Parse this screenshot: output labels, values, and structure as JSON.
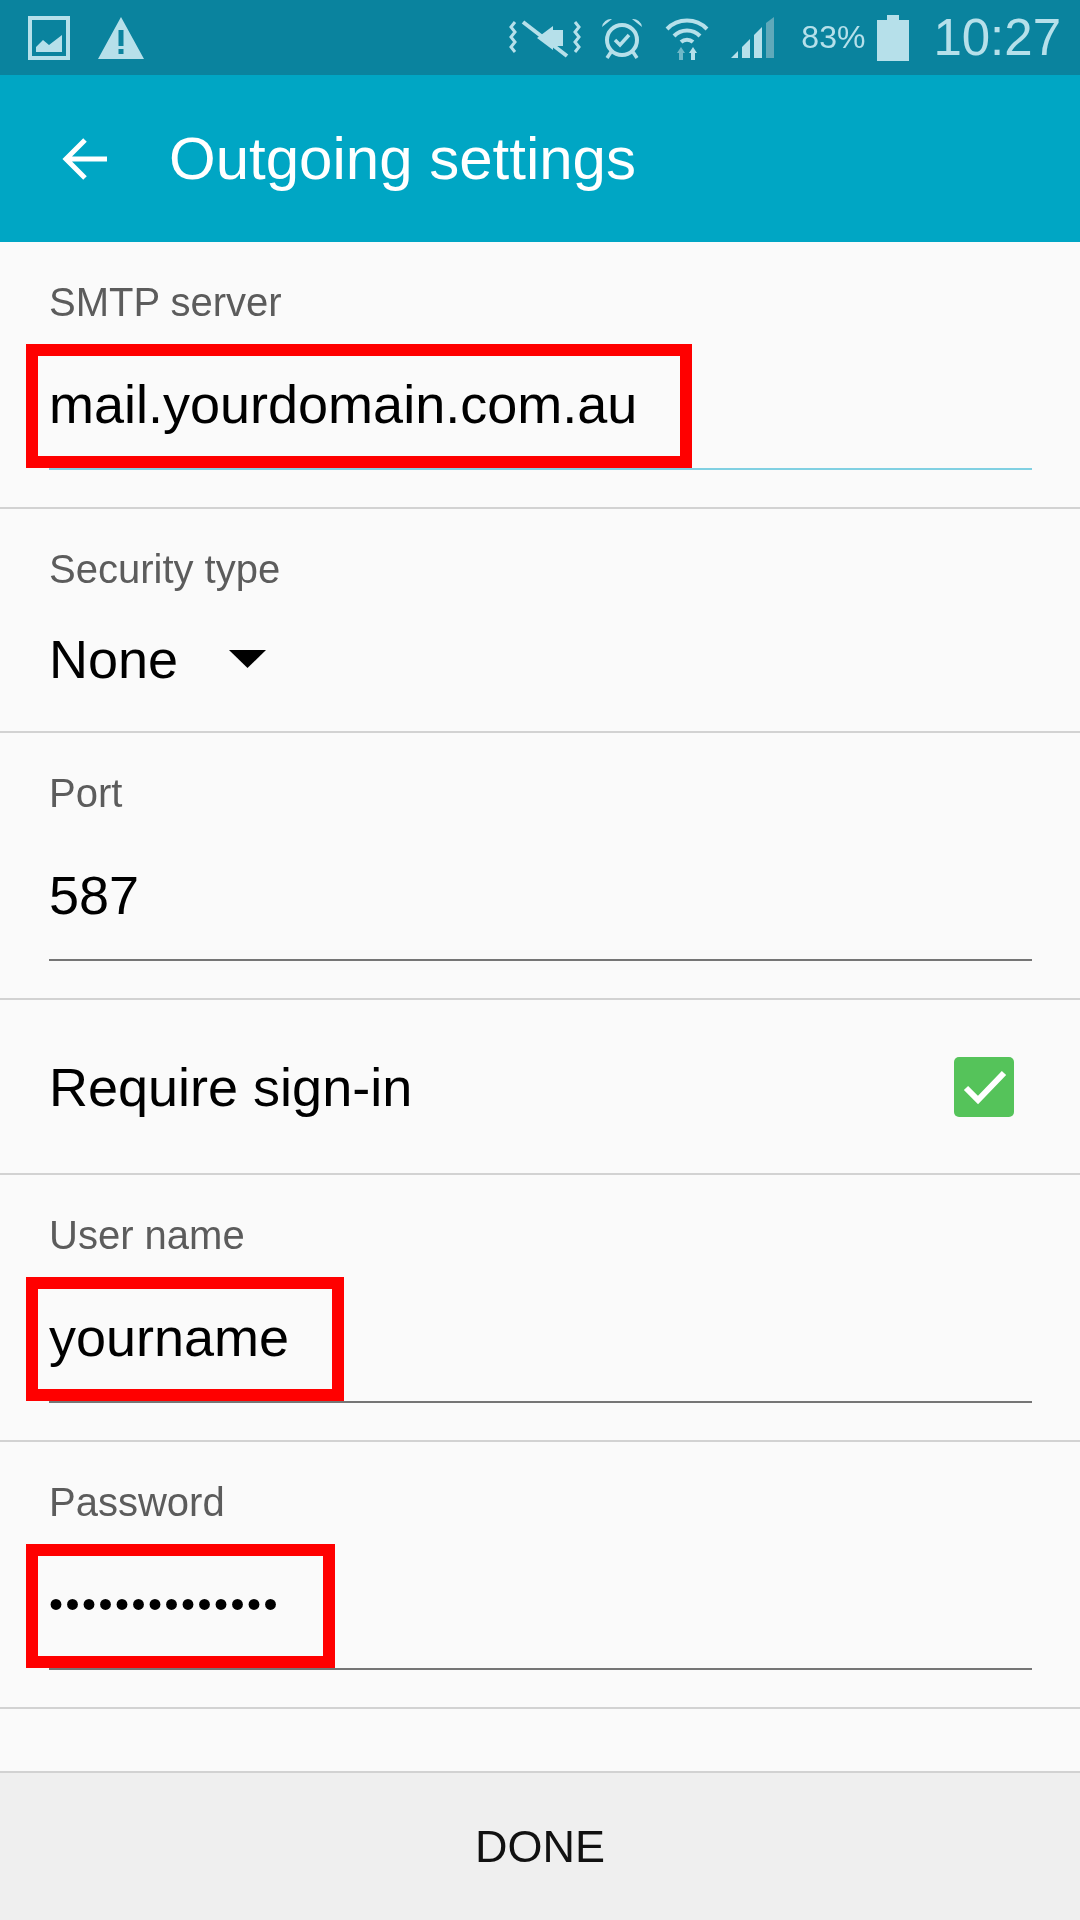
{
  "status_bar": {
    "battery_percent": "83%",
    "time": "10:27"
  },
  "app_bar": {
    "title": "Outgoing settings"
  },
  "fields": [
    {
      "kind": "text",
      "label": "SMTP server",
      "value": "mail.yourdomain.com.au",
      "focused": true,
      "highlighted": true
    },
    {
      "kind": "dropdown",
      "label": "Security type",
      "value": "None"
    },
    {
      "kind": "text",
      "label": "Port",
      "value": "587",
      "focused": false,
      "highlighted": false
    },
    {
      "kind": "checkbox",
      "label": "Require sign-in",
      "checked": true
    },
    {
      "kind": "text",
      "label": "User name",
      "value": "yourname",
      "focused": false,
      "highlighted": true
    },
    {
      "kind": "password",
      "label": "Password",
      "value": "••••••••••••••",
      "focused": false,
      "highlighted": true
    }
  ],
  "bottom_bar": {
    "button": "DONE"
  }
}
